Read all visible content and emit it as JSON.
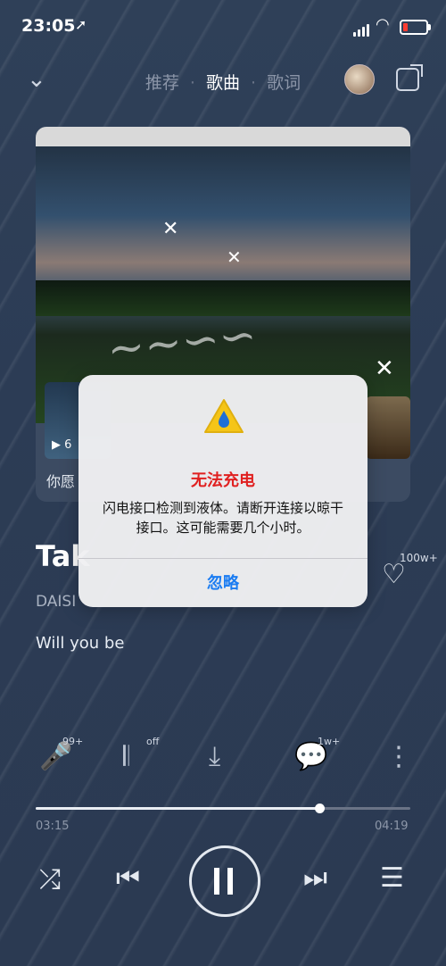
{
  "status_bar": {
    "time": "23:05",
    "location_icon": "location-arrow-icon",
    "signal_icon": "cellular-signal-icon",
    "wifi_icon": "wifi-icon",
    "battery_icon": "battery-low-icon"
  },
  "header": {
    "tabs": [
      {
        "label": "推荐",
        "active": false
      },
      {
        "label": "歌曲",
        "active": true
      },
      {
        "label": "歌词",
        "active": false
      }
    ],
    "back_icon": "chevron-down-icon",
    "share_icon": "share-icon"
  },
  "card": {
    "close_icon": "close-icon",
    "thumb_play_icon": "video-play-icon",
    "thumb_count": "6",
    "caption": "你愿"
  },
  "song": {
    "title": "Tak",
    "artist": "DAISI",
    "like_count": "100w+",
    "lyric": "Will you be"
  },
  "actions": [
    {
      "name": "sing-icon",
      "badge": "99+"
    },
    {
      "name": "sound-effect-icon",
      "badge": "off"
    },
    {
      "name": "download-icon",
      "badge": ""
    },
    {
      "name": "comment-icon",
      "badge": "1w+"
    },
    {
      "name": "more-icon",
      "badge": ""
    }
  ],
  "progress": {
    "current_time": "03:15",
    "duration": "04:19",
    "fraction": 0.757
  },
  "controls": {
    "shuffle_icon": "shuffle-icon",
    "prev_icon": "previous-track-icon",
    "pause_icon": "pause-icon",
    "next_icon": "next-track-icon",
    "playlist_icon": "playlist-icon"
  },
  "alert": {
    "icon": "water-drop-warning-icon",
    "title": "无法充电",
    "message": "闪电接口检测到液体。请断开连接以晾干接口。这可能需要几个小时。",
    "button": "忽略",
    "title_color": "#e02020",
    "button_color": "#1a7cf2"
  }
}
